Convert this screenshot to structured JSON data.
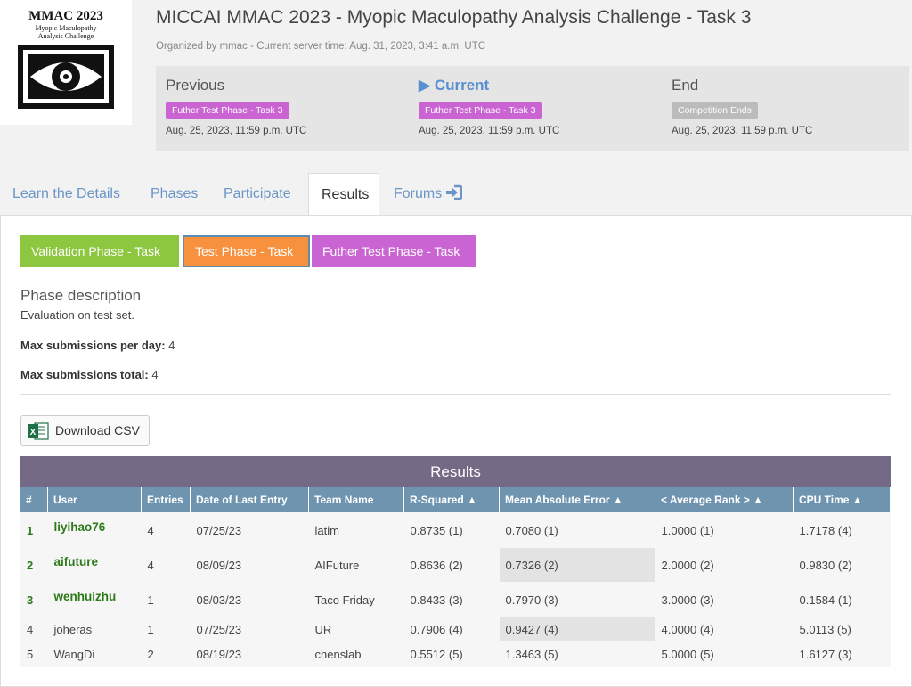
{
  "logo": {
    "title": "MMAC 2023",
    "subtitle_1": "Myopic Maculopathy",
    "subtitle_2": "Analysis Challenge"
  },
  "header": {
    "title": "MICCAI MMAC 2023 - Myopic Maculopathy Analysis Challenge - Task 3",
    "organized": "Organized by mmac - Current server time: Aug. 31, 2023, 3:41 a.m. UTC"
  },
  "phases": {
    "previous": {
      "title": "Previous",
      "tag": "Futher Test Phase - Task 3",
      "date": "Aug. 25, 2023, 11:59 p.m. UTC"
    },
    "current": {
      "title": "Current",
      "tag": "Futher Test Phase - Task 3",
      "date": "Aug. 25, 2023, 11:59 p.m. UTC"
    },
    "end": {
      "title": "End",
      "tag": "Competition Ends",
      "date": "Aug. 25, 2023, 11:59 p.m. UTC"
    }
  },
  "tabs": [
    "Learn the Details",
    "Phases",
    "Participate",
    "Results",
    "Forums"
  ],
  "phase_buttons": [
    "Validation Phase - Task 3",
    "Test Phase - Task 3",
    "Futher Test Phase - Task 3"
  ],
  "description": {
    "heading": "Phase description",
    "text": "Evaluation on test set.",
    "max_day_label": "Max submissions per day:",
    "max_day_value": "4",
    "max_total_label": "Max submissions total:",
    "max_total_value": "4"
  },
  "download_csv": "Download CSV",
  "results": {
    "heading": "Results",
    "columns": [
      "#",
      "User",
      "Entries",
      "Date of Last Entry",
      "Team Name",
      "R-Squared ▲",
      "Mean Absolute Error ▲",
      "< Average Rank > ▲",
      "CPU Time ▲"
    ],
    "rows": [
      {
        "rank": "1",
        "user": "liyihao76",
        "entries": "4",
        "date": "07/25/23",
        "team": "latim",
        "r2": "0.8735 (1)",
        "mae": "0.7080 (1)",
        "avg_rank": "1.0000 (1)",
        "cpu": "1.7178 (4)"
      },
      {
        "rank": "2",
        "user": "aifuture",
        "entries": "4",
        "date": "08/09/23",
        "team": "AIFuture",
        "r2": "0.8636 (2)",
        "mae": "0.7326 (2)",
        "avg_rank": "2.0000 (2)",
        "cpu": "0.9830 (2)"
      },
      {
        "rank": "3",
        "user": "wenhuizhu",
        "entries": "1",
        "date": "08/03/23",
        "team": "Taco Friday",
        "r2": "0.8433 (3)",
        "mae": "0.7970 (3)",
        "avg_rank": "3.0000 (3)",
        "cpu": "0.1584 (1)"
      },
      {
        "rank": "4",
        "user": "joheras",
        "entries": "1",
        "date": "07/25/23",
        "team": "UR",
        "r2": "0.7906 (4)",
        "mae": "0.9427 (4)",
        "avg_rank": "4.0000 (4)",
        "cpu": "5.0113 (5)"
      },
      {
        "rank": "5",
        "user": "WangDi",
        "entries": "2",
        "date": "08/19/23",
        "team": "chenslab",
        "r2": "0.5512 (5)",
        "mae": "1.3463 (5)",
        "avg_rank": "5.0000 (5)",
        "cpu": "1.6127 (3)"
      }
    ]
  }
}
